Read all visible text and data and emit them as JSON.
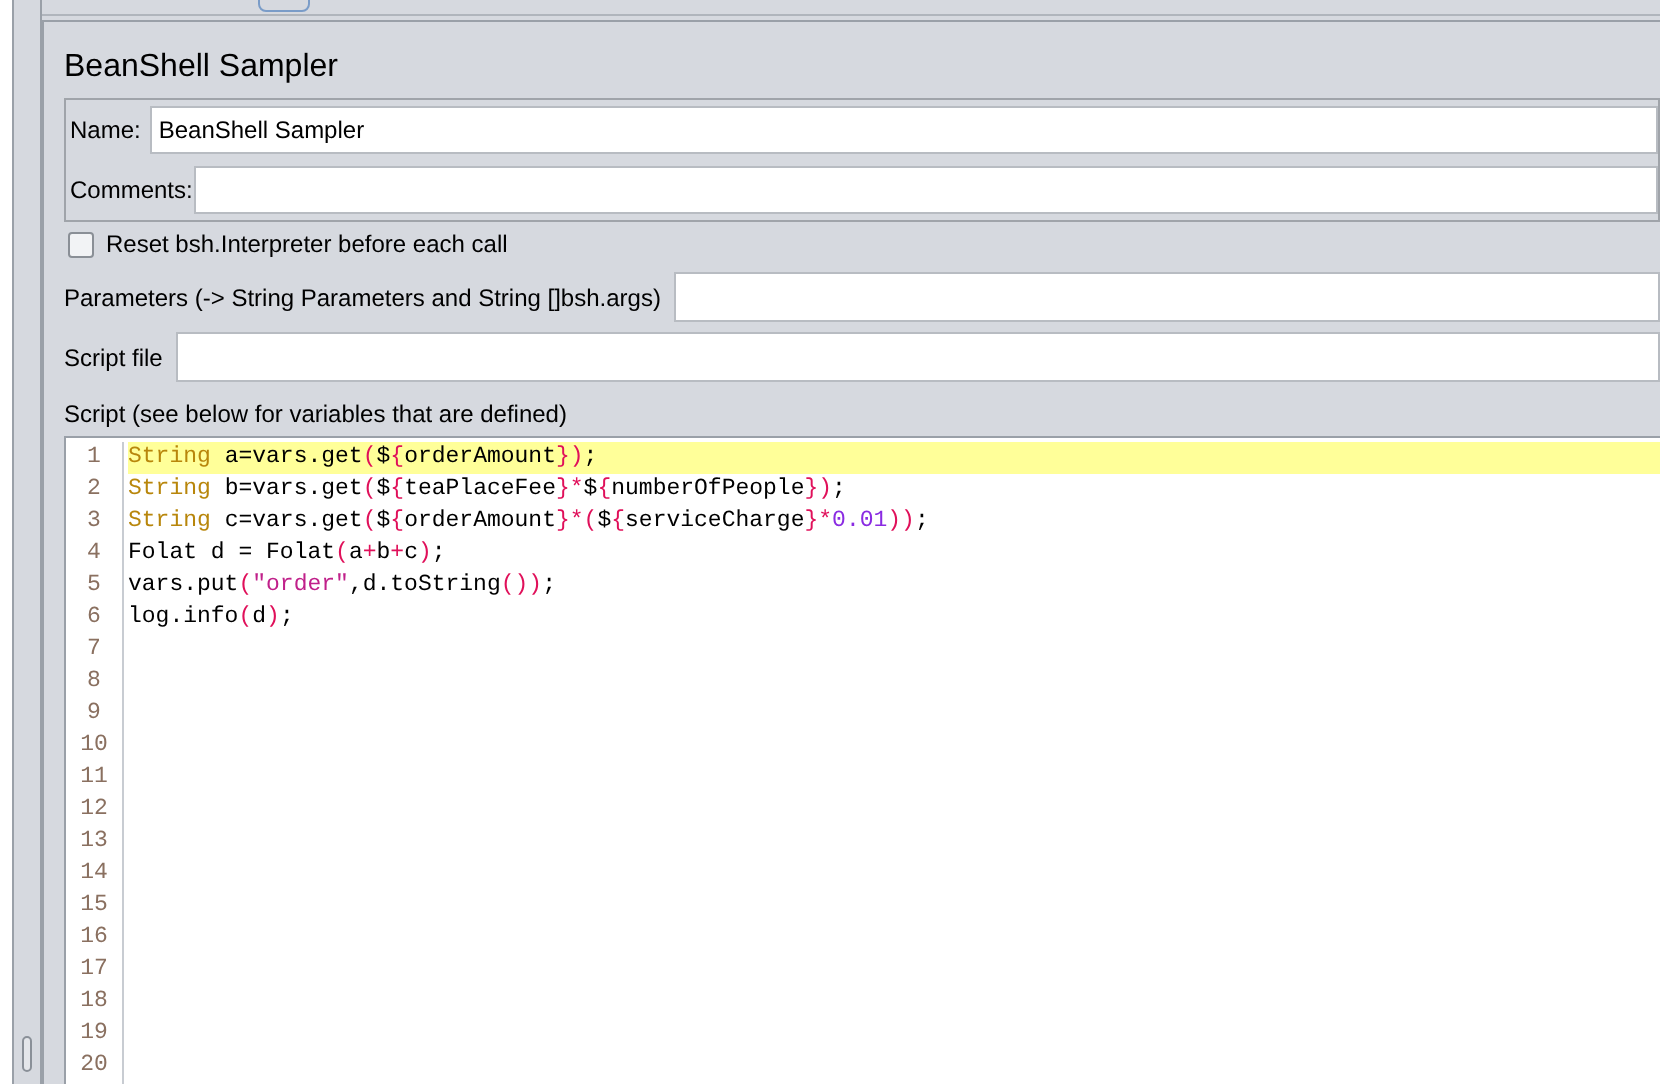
{
  "title": "BeanShell Sampler",
  "name_field": {
    "label": "Name:",
    "value": "BeanShell Sampler"
  },
  "comments_field": {
    "label": "Comments:"
  },
  "reset_checkbox": {
    "label": "Reset bsh.Interpreter before each call",
    "checked": false
  },
  "parameters_field": {
    "label": "Parameters (-> String Parameters and String []bsh.args)"
  },
  "script_file_field": {
    "label": "Script file"
  },
  "script": {
    "label": "Script (see below for variables that are defined)",
    "line_numbers": [
      "1",
      "2",
      "3",
      "4",
      "5",
      "6",
      "7",
      "8",
      "9",
      "10",
      "11",
      "12",
      "13",
      "14",
      "15",
      "16",
      "17",
      "18",
      "19",
      "20"
    ],
    "lines": [
      {
        "current": true,
        "tokens": [
          {
            "kind": "keyword",
            "text": "String"
          },
          {
            "kind": "plain",
            "text": " a=vars.get"
          },
          {
            "kind": "brace",
            "text": "("
          },
          {
            "kind": "plain",
            "text": "$"
          },
          {
            "kind": "brace",
            "text": "{"
          },
          {
            "kind": "plain",
            "text": "orderAmount"
          },
          {
            "kind": "brace",
            "text": "})"
          },
          {
            "kind": "plain",
            "text": ";"
          }
        ]
      },
      {
        "current": false,
        "tokens": [
          {
            "kind": "keyword",
            "text": "String"
          },
          {
            "kind": "plain",
            "text": " b=vars.get"
          },
          {
            "kind": "brace",
            "text": "("
          },
          {
            "kind": "plain",
            "text": "$"
          },
          {
            "kind": "brace",
            "text": "{"
          },
          {
            "kind": "plain",
            "text": "teaPlaceFee"
          },
          {
            "kind": "brace",
            "text": "}*"
          },
          {
            "kind": "plain",
            "text": "$"
          },
          {
            "kind": "brace",
            "text": "{"
          },
          {
            "kind": "plain",
            "text": "numberOfPeople"
          },
          {
            "kind": "brace",
            "text": "})"
          },
          {
            "kind": "plain",
            "text": ";"
          }
        ]
      },
      {
        "current": false,
        "tokens": [
          {
            "kind": "keyword",
            "text": "String"
          },
          {
            "kind": "plain",
            "text": " c=vars.get"
          },
          {
            "kind": "brace",
            "text": "("
          },
          {
            "kind": "plain",
            "text": "$"
          },
          {
            "kind": "brace",
            "text": "{"
          },
          {
            "kind": "plain",
            "text": "orderAmount"
          },
          {
            "kind": "brace",
            "text": "}*("
          },
          {
            "kind": "plain",
            "text": "$"
          },
          {
            "kind": "brace",
            "text": "{"
          },
          {
            "kind": "plain",
            "text": "serviceCharge"
          },
          {
            "kind": "brace",
            "text": "}*"
          },
          {
            "kind": "number",
            "text": "0.01"
          },
          {
            "kind": "brace",
            "text": "))"
          },
          {
            "kind": "plain",
            "text": ";"
          }
        ]
      },
      {
        "current": false,
        "tokens": [
          {
            "kind": "plain",
            "text": "Folat d = Folat"
          },
          {
            "kind": "brace",
            "text": "("
          },
          {
            "kind": "plain",
            "text": "a"
          },
          {
            "kind": "brace",
            "text": "+"
          },
          {
            "kind": "plain",
            "text": "b"
          },
          {
            "kind": "brace",
            "text": "+"
          },
          {
            "kind": "plain",
            "text": "c"
          },
          {
            "kind": "brace",
            "text": ")"
          },
          {
            "kind": "plain",
            "text": ";"
          }
        ]
      },
      {
        "current": false,
        "tokens": [
          {
            "kind": "plain",
            "text": "vars.put"
          },
          {
            "kind": "brace",
            "text": "("
          },
          {
            "kind": "string",
            "text": "\"order\""
          },
          {
            "kind": "plain",
            "text": ",d.toString"
          },
          {
            "kind": "brace",
            "text": "())"
          },
          {
            "kind": "plain",
            "text": ";"
          }
        ]
      },
      {
        "current": false,
        "tokens": [
          {
            "kind": "plain",
            "text": "log.info"
          },
          {
            "kind": "brace",
            "text": "("
          },
          {
            "kind": "plain",
            "text": "d"
          },
          {
            "kind": "brace",
            "text": ")"
          },
          {
            "kind": "plain",
            "text": ";"
          }
        ]
      }
    ]
  }
}
